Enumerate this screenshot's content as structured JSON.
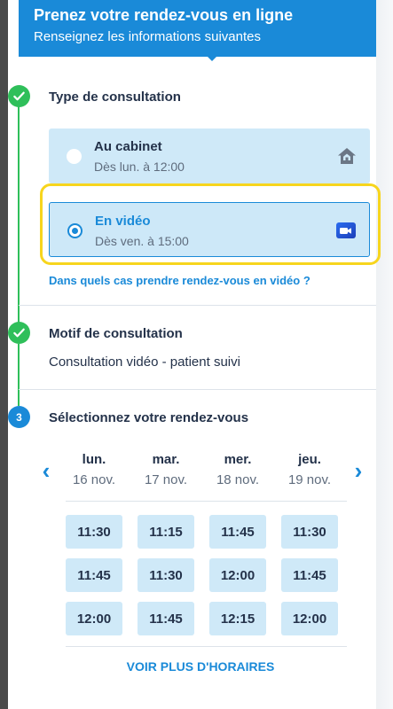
{
  "header": {
    "title": "Prenez votre rendez-vous en ligne",
    "subtitle": "Renseignez les informations suivantes"
  },
  "steps": [
    {
      "state": "done",
      "marker": "check-icon",
      "title": "Type de consultation"
    },
    {
      "state": "done",
      "marker": "check-icon",
      "title": "Motif de consultation"
    },
    {
      "state": "current",
      "marker": "3",
      "title": "Sélectionnez votre rendez-vous"
    }
  ],
  "consultation_type": {
    "options": [
      {
        "title": "Au cabinet",
        "subtitle": "Dès lun. à 12:00",
        "icon": "home-icon",
        "selected": false
      },
      {
        "title": "En vidéo",
        "subtitle": "Dès ven. à 15:00",
        "icon": "video-camera-icon",
        "selected": true
      }
    ],
    "help_link": "Dans quels cas prendre rendez-vous en vidéo ?"
  },
  "motif": {
    "value": "Consultation vidéo - patient suivi"
  },
  "calendar": {
    "prev_icon": "chevron-left-icon",
    "next_icon": "chevron-right-icon",
    "days": [
      {
        "name": "lun.",
        "date": "16 nov.",
        "slots": [
          "11:30",
          "11:45",
          "12:00"
        ]
      },
      {
        "name": "mar.",
        "date": "17 nov.",
        "slots": [
          "11:15",
          "11:30",
          "11:45"
        ]
      },
      {
        "name": "mer.",
        "date": "18 nov.",
        "slots": [
          "11:45",
          "12:00",
          "12:15"
        ]
      },
      {
        "name": "jeu.",
        "date": "19 nov.",
        "slots": [
          "11:30",
          "11:45",
          "12:00"
        ]
      }
    ],
    "more_label": "VOIR PLUS D'HORAIRES"
  },
  "colors": {
    "primary": "#1a8ad8",
    "success": "#2fbf5a",
    "slot_bg": "#cfe9f8",
    "highlight": "#f7d51d"
  }
}
